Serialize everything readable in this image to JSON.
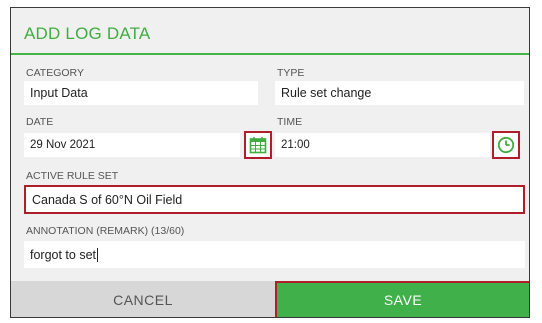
{
  "dialog": {
    "title": "ADD LOG DATA"
  },
  "category": {
    "label": "CATEGORY",
    "value": "Input Data"
  },
  "type": {
    "label": "TYPE",
    "value": "Rule set change"
  },
  "date": {
    "label": "DATE",
    "value": "29 Nov 2021",
    "icon": "calendar-icon"
  },
  "time": {
    "label": "TIME",
    "value": "21:00",
    "icon": "clock-icon"
  },
  "active_rule_set": {
    "label": "ACTIVE RULE SET",
    "value": "Canada S of 60°N Oil Field"
  },
  "annotation": {
    "label": "ANNOTATION (REMARK) (13/60)",
    "value": "forgot to set"
  },
  "footer": {
    "cancel_label": "CANCEL",
    "save_label": "SAVE"
  },
  "colors": {
    "accent_green": "#3fae3f",
    "highlight_red": "#b01e2c",
    "save_green": "#3fb04a",
    "cancel_gray": "#d7d7d7"
  }
}
